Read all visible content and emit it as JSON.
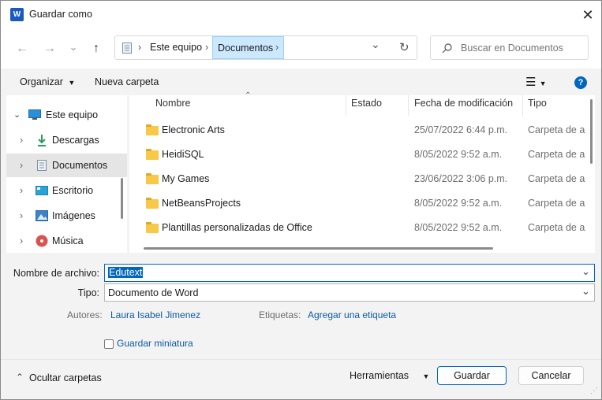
{
  "window": {
    "title": "Guardar como",
    "app_icon_letter": "W",
    "close_glyph": "✕"
  },
  "nav": {
    "back_glyph": "←",
    "forward_glyph": "→",
    "recent_glyph": "⌄",
    "up_glyph": "↑",
    "breadcrumb": [
      "Este equipo",
      "Documentos"
    ],
    "separator_glyph": "›",
    "refresh_glyph": "↻",
    "dropdown_glyph": "⌄"
  },
  "search": {
    "placeholder": "Buscar en Documentos",
    "icon": "search-icon"
  },
  "toolbar": {
    "organize": "Organizar",
    "new_folder": "Nueva carpeta",
    "help_glyph": "?"
  },
  "sidebar": {
    "items": [
      {
        "label": "Este equipo",
        "icon": "computer-icon",
        "color": "#2b8fd6"
      },
      {
        "label": "Descargas",
        "icon": "download-icon",
        "color": "#2a9d5c"
      },
      {
        "label": "Documentos",
        "icon": "document-icon",
        "color": "#7e8fa6"
      },
      {
        "label": "Escritorio",
        "icon": "desktop-icon",
        "color": "#2aa3d9"
      },
      {
        "label": "Imágenes",
        "icon": "pictures-icon",
        "color": "#3b82c9"
      },
      {
        "label": "Música",
        "icon": "music-icon",
        "color": "#d9534f"
      }
    ]
  },
  "table": {
    "columns": [
      "Nombre",
      "Estado",
      "Fecha de modificación",
      "Tipo"
    ],
    "rows": [
      {
        "name": "Electronic Arts",
        "date": "25/07/2022 6:44 p.m.",
        "type": "Carpeta de arc"
      },
      {
        "name": "HeidiSQL",
        "date": "8/05/2022 9:52 a.m.",
        "type": "Carpeta de arc"
      },
      {
        "name": "My Games",
        "date": "23/06/2022 3:06 p.m.",
        "type": "Carpeta de arc"
      },
      {
        "name": "NetBeansProjects",
        "date": "8/05/2022 9:52 a.m.",
        "type": "Carpeta de arc"
      },
      {
        "name": "Plantillas personalizadas de Office",
        "date": "8/05/2022 9:52 a.m.",
        "type": "Carpeta de arc"
      }
    ]
  },
  "form": {
    "filename_label": "Nombre de archivo:",
    "filename_value": "Edutext",
    "type_label": "Tipo:",
    "type_value": "Documento de Word",
    "authors_label": "Autores:",
    "authors_value": "Laura Isabel Jimenez",
    "tags_label": "Etiquetas:",
    "tags_value": "Agregar una etiqueta",
    "thumbnail_label": "Guardar miniatura"
  },
  "footer": {
    "hide_folders": "Ocultar carpetas",
    "tools": "Herramientas",
    "save": "Guardar",
    "cancel": "Cancelar"
  },
  "colors": {
    "accent": "#0067c0",
    "selection": "#cce8ff"
  }
}
